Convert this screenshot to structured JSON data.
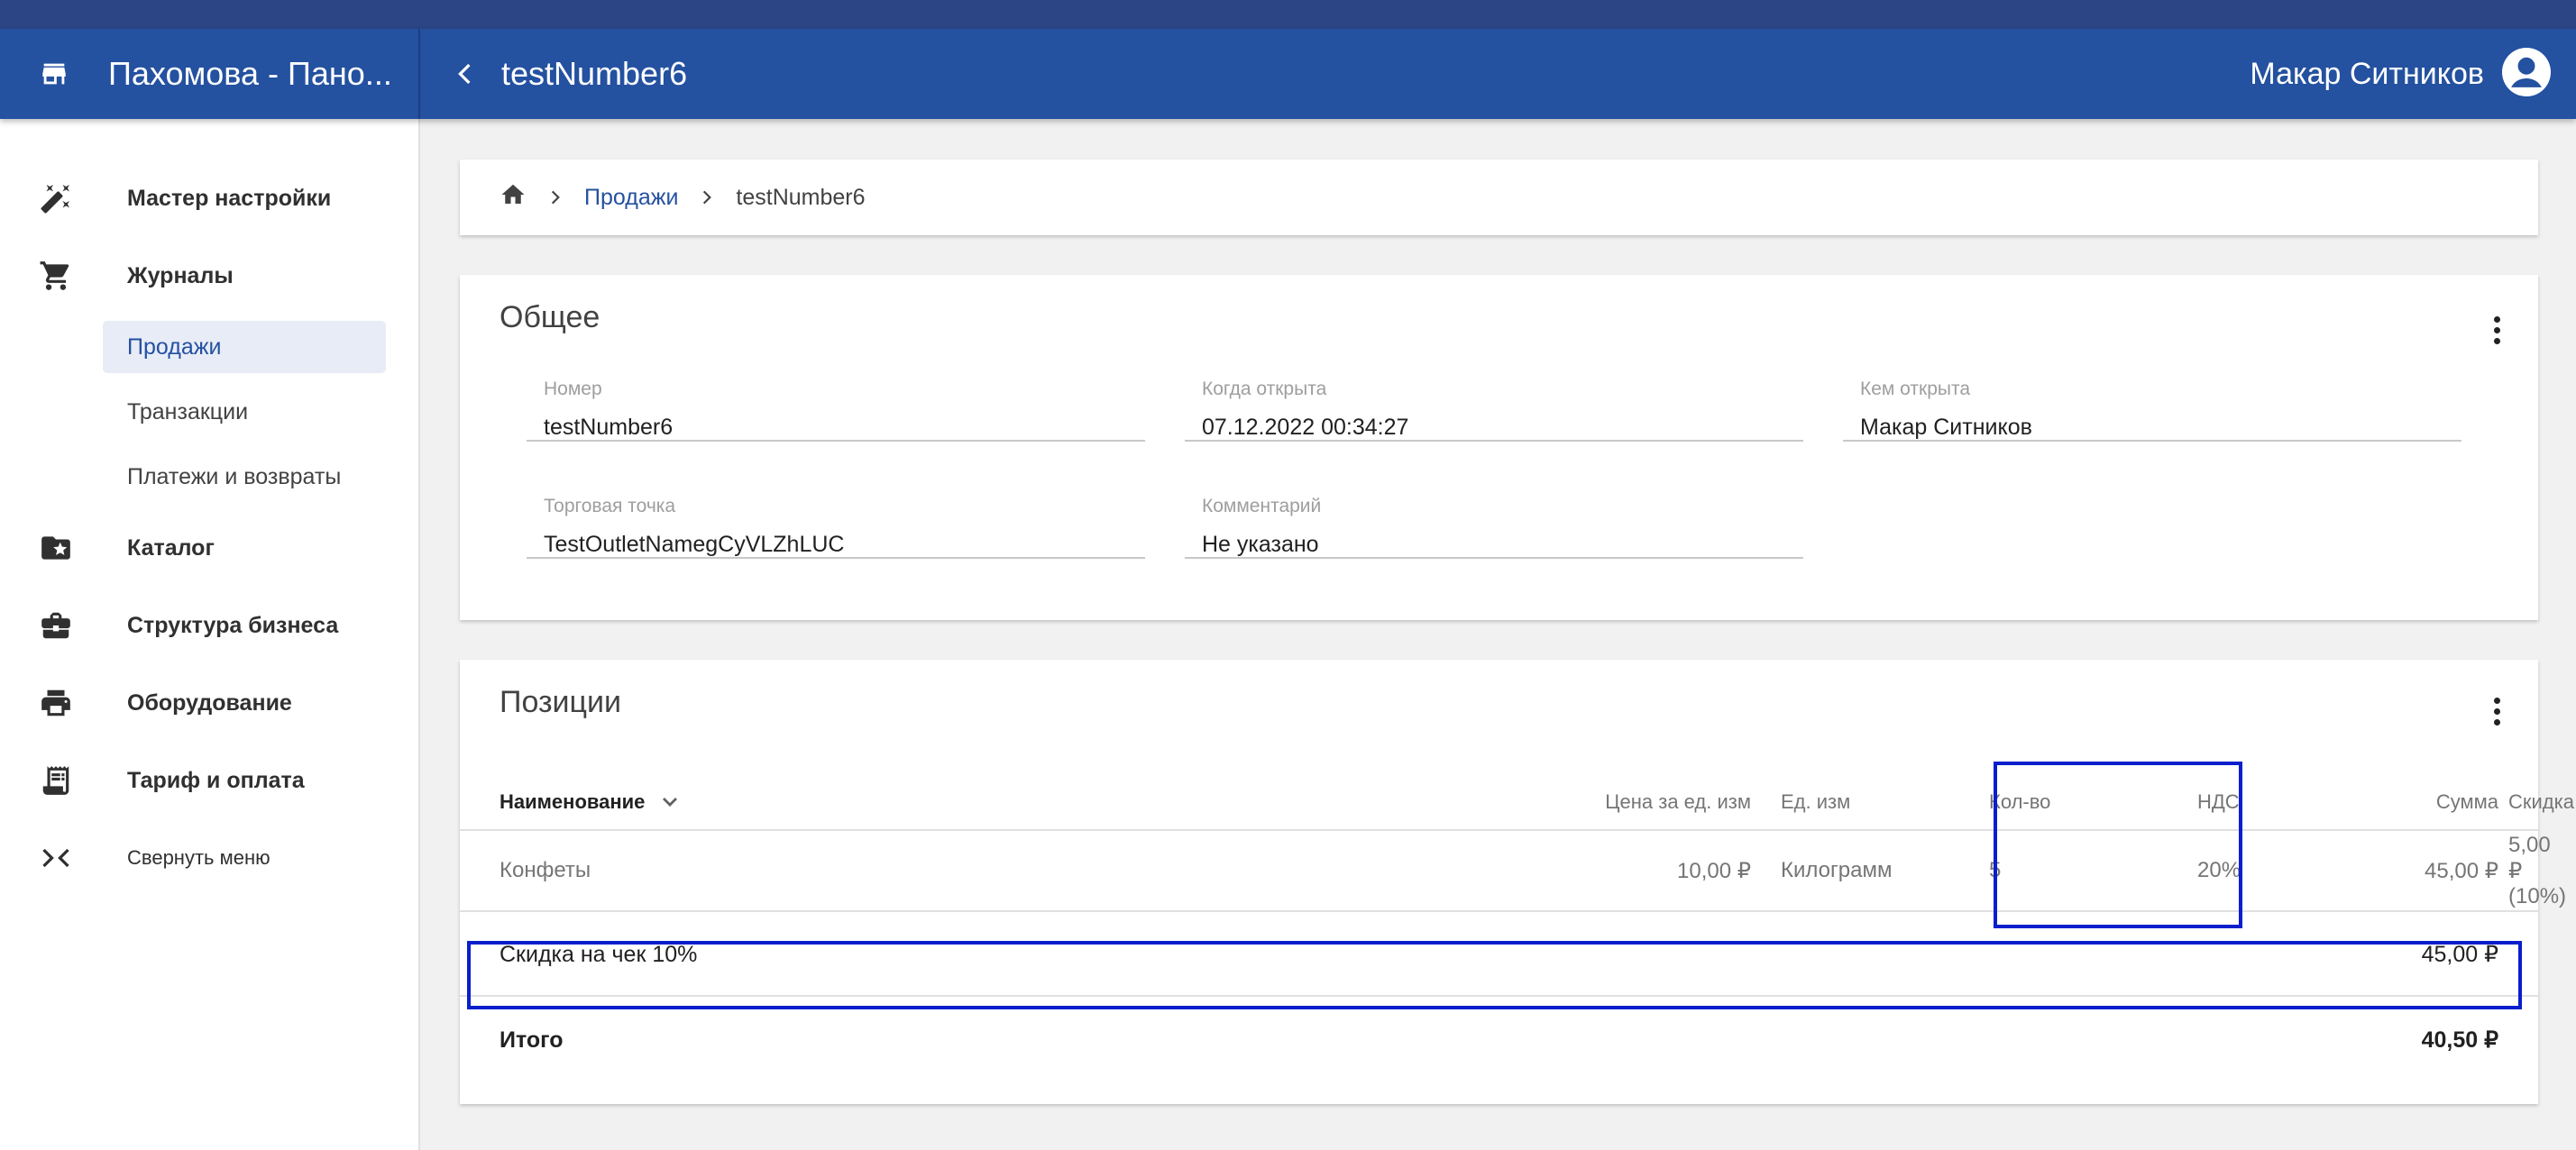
{
  "header": {
    "store_name": "Пахомова - Пано...",
    "page_title": "testNumber6",
    "user_name": "Макар Ситников"
  },
  "sidebar": {
    "items": [
      {
        "label": "Мастер настройки",
        "icon": "magic-wand-icon"
      },
      {
        "label": "Журналы",
        "icon": "cart-icon"
      },
      {
        "label": "Каталог",
        "icon": "folder-star-icon"
      },
      {
        "label": "Структура бизнеса",
        "icon": "briefcase-icon"
      },
      {
        "label": "Оборудование",
        "icon": "printer-icon"
      },
      {
        "label": "Тариф и оплата",
        "icon": "receipt-icon"
      },
      {
        "label": "Свернуть меню",
        "icon": "collapse-icon"
      }
    ],
    "journal_subitems": [
      "Продажи",
      "Транзакции",
      "Платежи и возвраты"
    ]
  },
  "breadcrumb": {
    "link": "Продажи",
    "current": "testNumber6"
  },
  "general": {
    "title": "Общее",
    "fields": {
      "number": {
        "label": "Номер",
        "value": "testNumber6"
      },
      "opened_at": {
        "label": "Когда открыта",
        "value": "07.12.2022 00:34:27"
      },
      "opened_by": {
        "label": "Кем открыта",
        "value": "Макар Ситников"
      },
      "outlet": {
        "label": "Торговая точка",
        "value": "TestOutletNamegCyVLZhLUC"
      },
      "comment": {
        "label": "Комментарий",
        "value": "Не указано"
      }
    }
  },
  "positions": {
    "title": "Позиции",
    "columns": {
      "name": "Наименование",
      "price": "Цена за ед. изм",
      "unit": "Ед. изм",
      "qty": "Кол-во",
      "vat": "НДС",
      "discount": "Скидка",
      "sum": "Сумма"
    },
    "rows": [
      {
        "name": "Конфеты",
        "price": "10,00 ₽",
        "unit": "Килограмм",
        "qty": "5",
        "vat": "20%",
        "discount": "5,00 ₽ (10%)",
        "sum": "45,00 ₽"
      }
    ],
    "receipt_discount": {
      "label": "Скидка на чек 10%",
      "value": "45,00 ₽"
    },
    "total": {
      "label": "Итого",
      "value": "40,50 ₽"
    }
  },
  "colors": {
    "appbar": "#2451a0",
    "highlight": "#0a1ecc"
  }
}
